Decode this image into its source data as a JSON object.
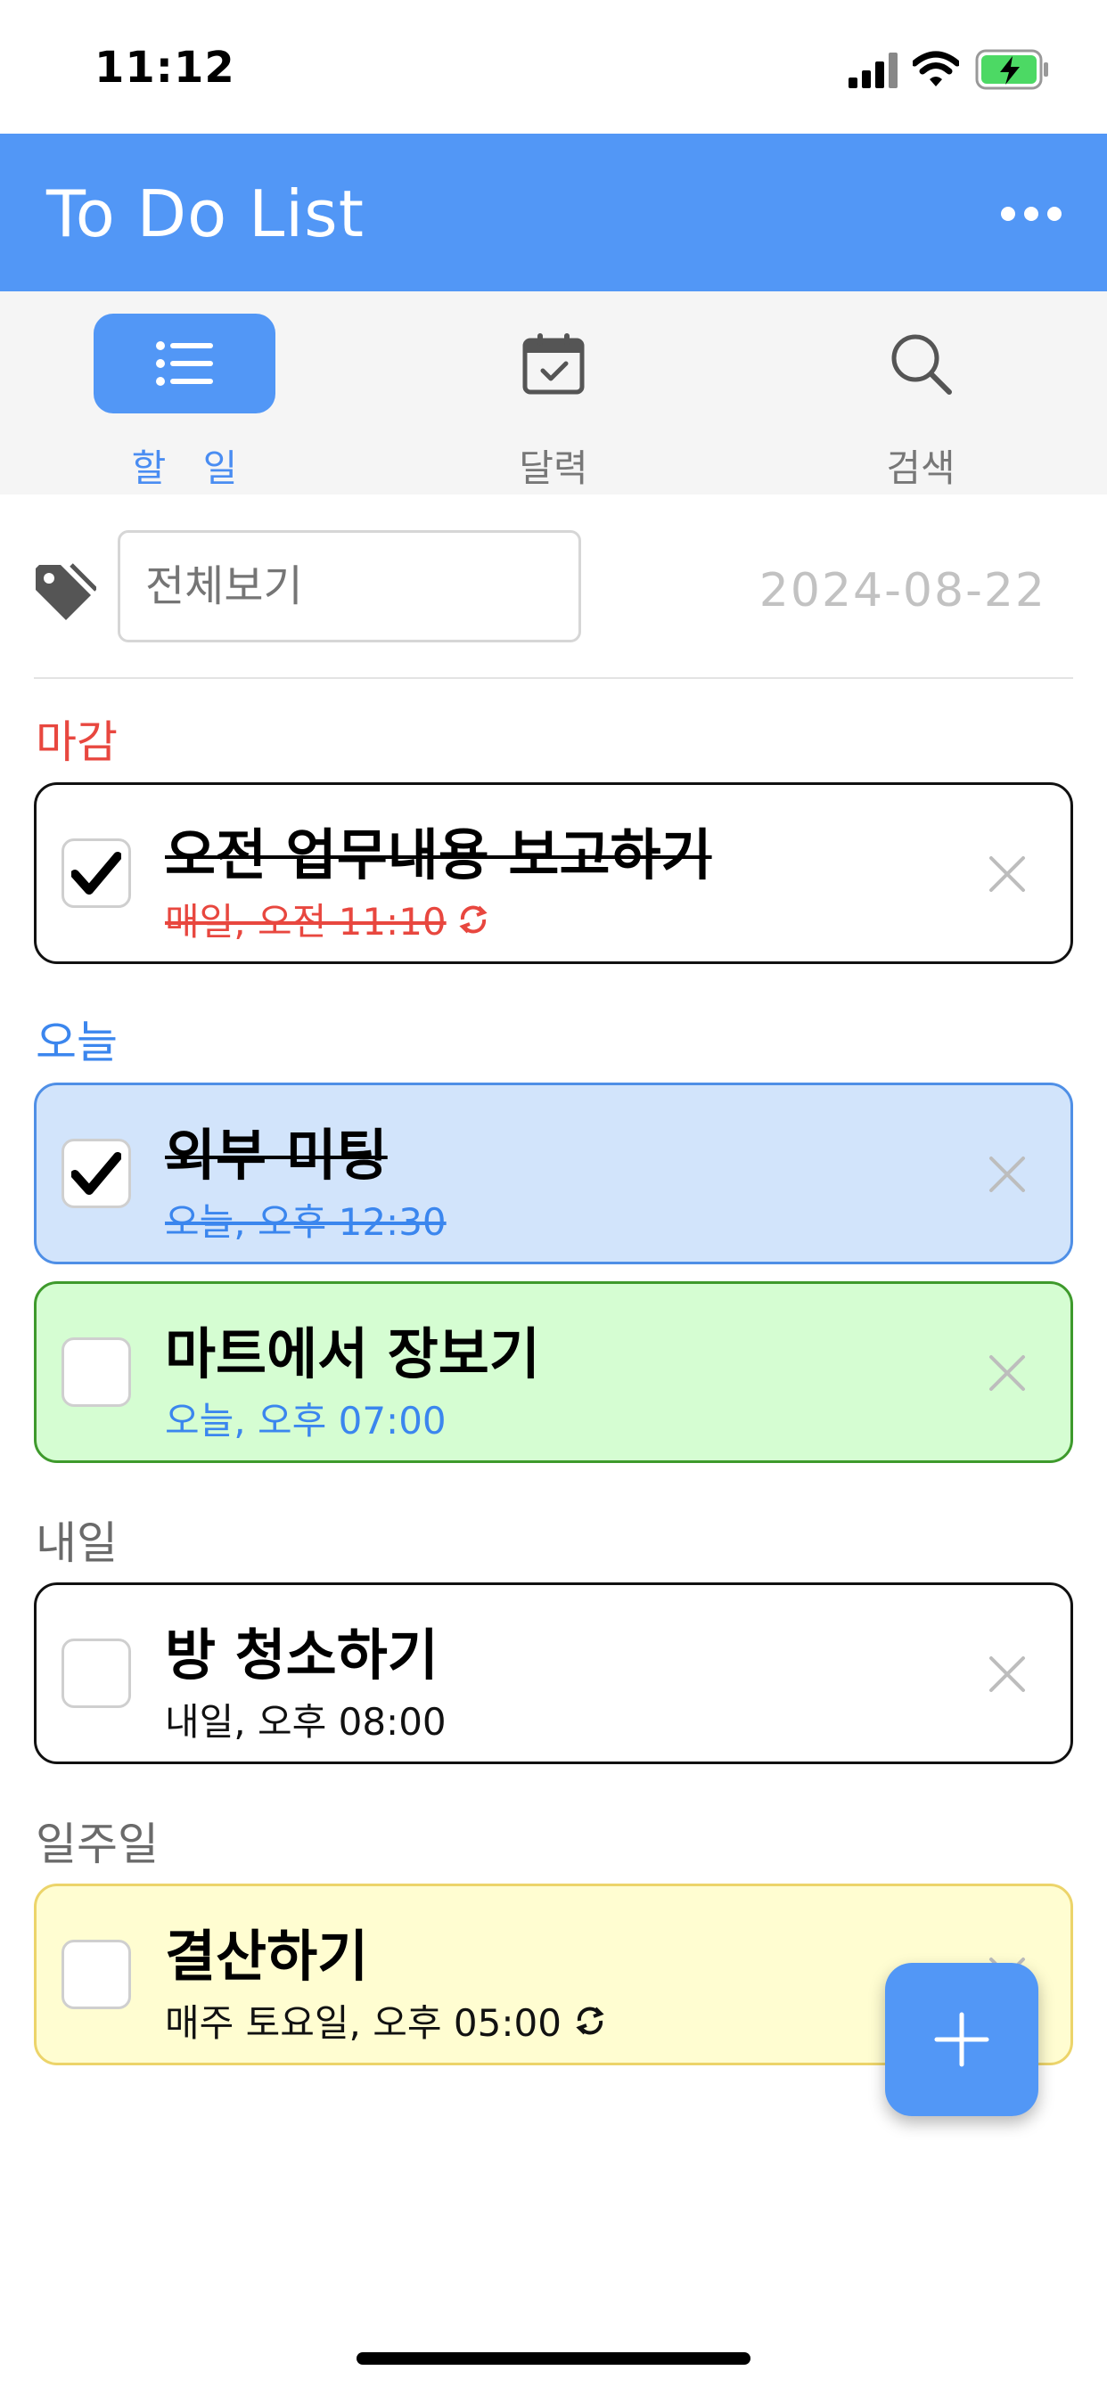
{
  "status_bar": {
    "time": "11:12"
  },
  "header": {
    "title": "To Do List"
  },
  "tabs": [
    {
      "label": "할 일",
      "icon": "list-icon",
      "active": true
    },
    {
      "label": "달력",
      "icon": "calendar-icon",
      "active": false
    },
    {
      "label": "검색",
      "icon": "search-icon",
      "active": false
    }
  ],
  "filter": {
    "placeholder": "전체보기",
    "date": "2024-08-22"
  },
  "sections": [
    {
      "title": "마감",
      "title_color": "#e8473f",
      "tasks": [
        {
          "title": "오전 업무내용 보고하기",
          "subtitle": "매일, 오전 11:10",
          "done": true,
          "repeat": true,
          "bg": "#ffffff",
          "border": "#111111",
          "sub_color": "#e8473f"
        }
      ]
    },
    {
      "title": "오늘",
      "title_color": "#3b86ee",
      "tasks": [
        {
          "title": "외부 미팅",
          "subtitle": "오늘, 오후 12:30",
          "done": true,
          "repeat": false,
          "bg": "#d2e4fb",
          "border": "#4f8fe6",
          "sub_color": "#3b86ee"
        },
        {
          "title": "마트에서 장보기",
          "subtitle": "오늘, 오후 07:00",
          "done": false,
          "repeat": false,
          "bg": "#d5fdd2",
          "border": "#3e9a2c",
          "sub_color": "#3b86ee"
        }
      ]
    },
    {
      "title": "내일",
      "title_color": "#6a6a6a",
      "tasks": [
        {
          "title": "방 청소하기",
          "subtitle": "내일, 오후 08:00",
          "done": false,
          "repeat": false,
          "bg": "#ffffff",
          "border": "#111111",
          "sub_color": "#111111"
        }
      ]
    },
    {
      "title": "일주일",
      "title_color": "#6a6a6a",
      "tasks": [
        {
          "title": "결산하기",
          "subtitle": "매주 토요일, 오후 05:00",
          "done": false,
          "repeat": true,
          "bg": "#fffdd1",
          "border": "#ecd46a",
          "sub_color": "#111111"
        }
      ]
    }
  ],
  "colors": {
    "accent": "#5297f6",
    "header_bg": "#5297f6"
  }
}
